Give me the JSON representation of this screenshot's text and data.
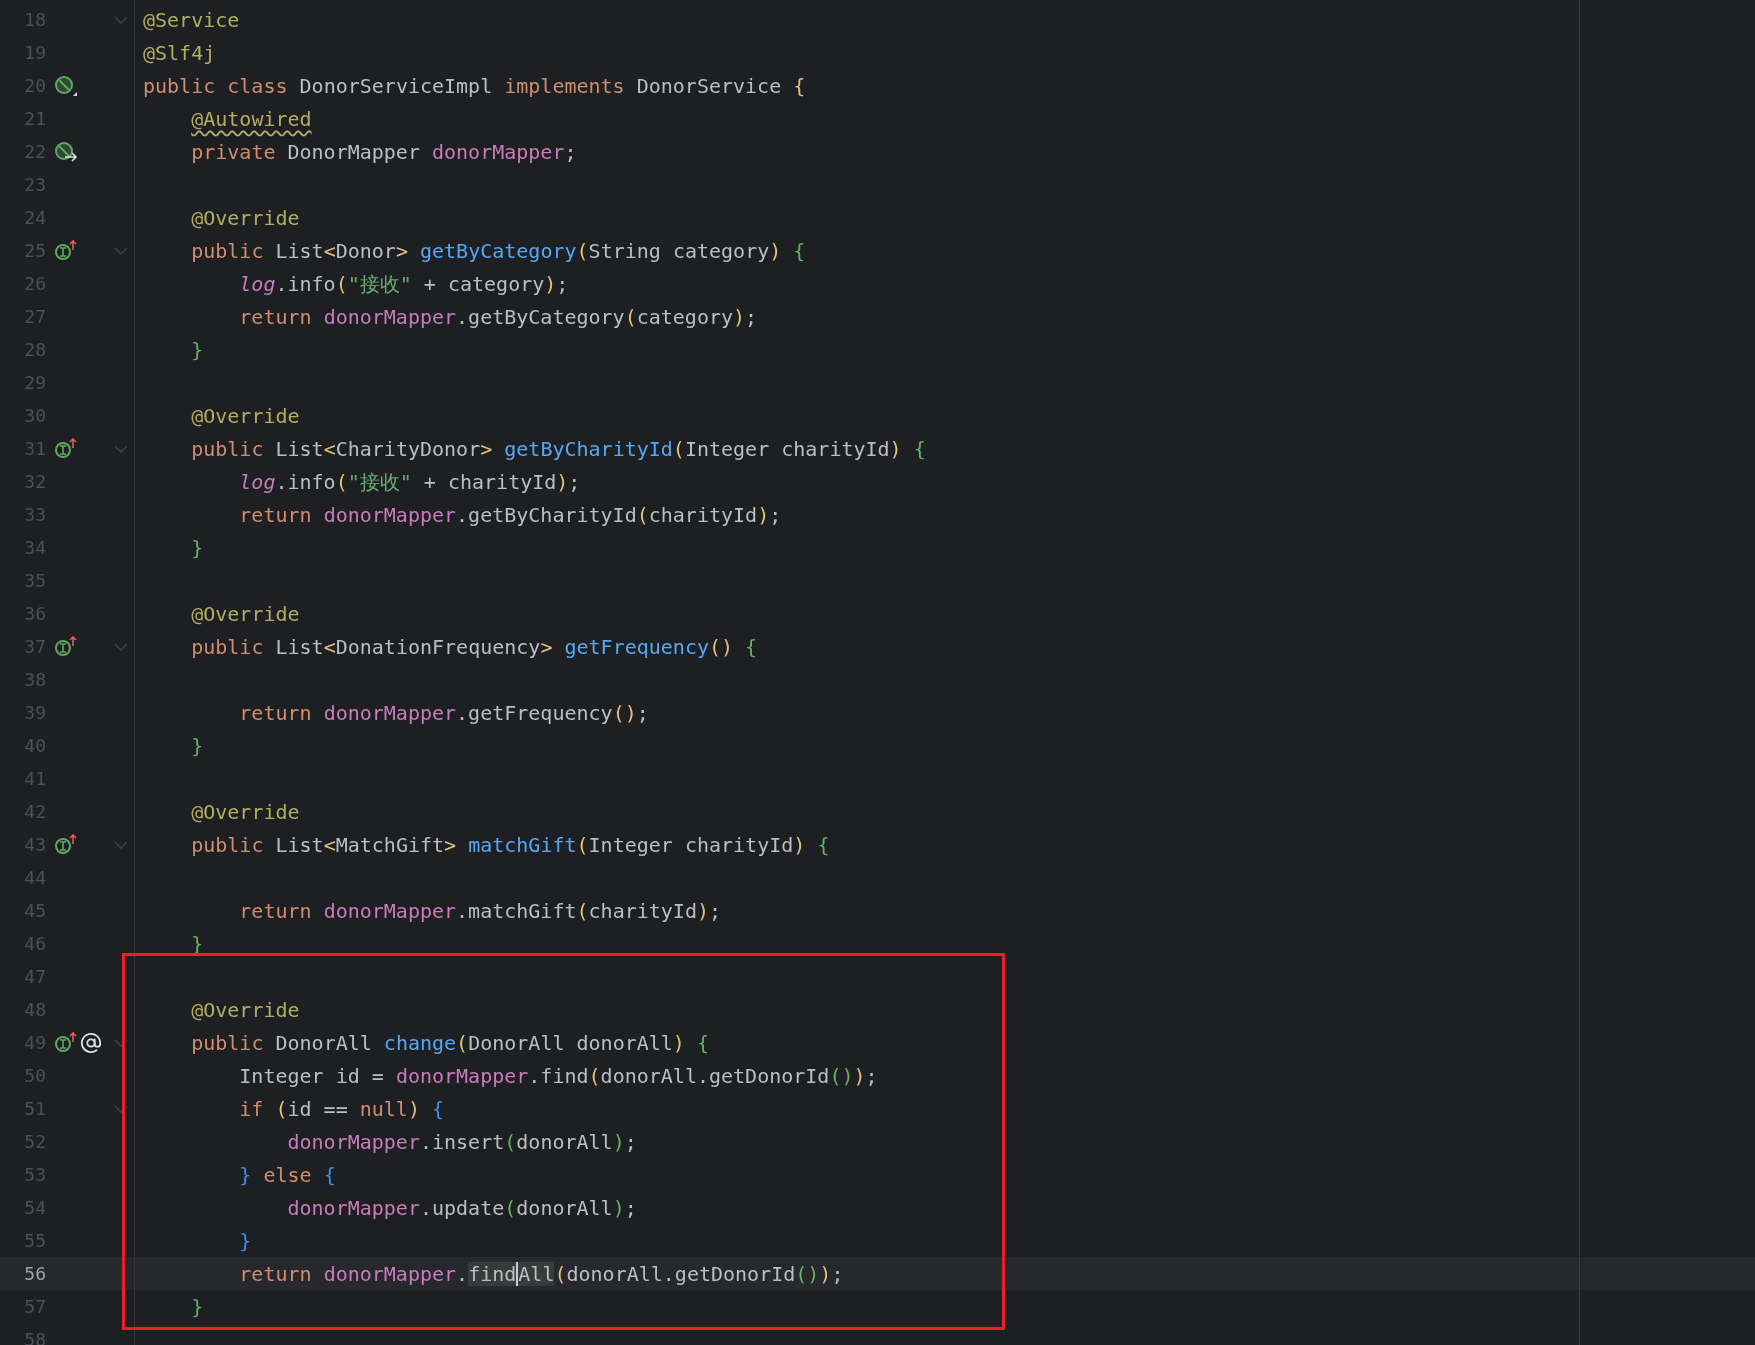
{
  "editor": {
    "lines": [
      {
        "number": "18",
        "fold": true,
        "current": false,
        "tokens": [
          {
            "kind": "annotation",
            "text": "@Service"
          }
        ]
      },
      {
        "number": "19",
        "fold": false,
        "current": false,
        "tokens": [
          {
            "kind": "annotation",
            "text": "@Slf4j"
          }
        ]
      },
      {
        "number": "20",
        "fold": false,
        "current": false,
        "gutter_icons": [
          {
            "kind": "bean"
          }
        ],
        "tokens": [
          {
            "kind": "keyword",
            "text": "public class "
          },
          {
            "kind": "plain",
            "text": "DonorServiceImpl "
          },
          {
            "kind": "keyword",
            "text": "implements "
          },
          {
            "kind": "plain",
            "text": "DonorService "
          },
          {
            "kind": "bracket1",
            "text": "{"
          }
        ]
      },
      {
        "number": "21",
        "fold": false,
        "current": false,
        "tokens": [
          {
            "kind": "annotation-warning",
            "text": "    @Autowired"
          }
        ]
      },
      {
        "number": "22",
        "fold": false,
        "current": false,
        "gutter_icons": [
          {
            "kind": "bean-inject"
          }
        ],
        "tokens": [
          {
            "kind": "keyword",
            "text": "    private "
          },
          {
            "kind": "plain",
            "text": "DonorMapper "
          },
          {
            "kind": "field",
            "text": "donorMapper"
          },
          {
            "kind": "plain",
            "text": ";"
          }
        ]
      },
      {
        "number": "23",
        "fold": false,
        "current": false
      },
      {
        "number": "24",
        "fold": false,
        "current": false,
        "tokens": [
          {
            "kind": "annotation",
            "text": "    @Override"
          }
        ]
      },
      {
        "number": "25",
        "fold": true,
        "current": false,
        "gutter_icons": [
          {
            "kind": "implements"
          }
        ],
        "tokens": [
          {
            "kind": "keyword",
            "text": "    public "
          },
          {
            "kind": "plain",
            "text": "List"
          },
          {
            "kind": "bracket1",
            "text": "<"
          },
          {
            "kind": "plain",
            "text": "Donor"
          },
          {
            "kind": "bracket1",
            "text": "> "
          },
          {
            "kind": "function",
            "text": "getByCategory"
          },
          {
            "kind": "bracket1",
            "text": "("
          },
          {
            "kind": "plain",
            "text": "String category"
          },
          {
            "kind": "bracket1",
            "text": ") "
          },
          {
            "kind": "bracket2",
            "text": "{"
          }
        ]
      },
      {
        "number": "26",
        "fold": false,
        "current": false,
        "tokens": [
          {
            "kind": "static",
            "text": "        log"
          },
          {
            "kind": "plain",
            "text": ".info"
          },
          {
            "kind": "bracket1",
            "text": "("
          },
          {
            "kind": "string",
            "text": "\"接收\""
          },
          {
            "kind": "plain",
            "text": " + category"
          },
          {
            "kind": "bracket1",
            "text": ")"
          },
          {
            "kind": "plain",
            "text": ";"
          }
        ]
      },
      {
        "number": "27",
        "fold": false,
        "current": false,
        "tokens": [
          {
            "kind": "keyword",
            "text": "        return "
          },
          {
            "kind": "field",
            "text": "donorMapper"
          },
          {
            "kind": "plain",
            "text": ".getByCategory"
          },
          {
            "kind": "bracket1",
            "text": "("
          },
          {
            "kind": "plain",
            "text": "category"
          },
          {
            "kind": "bracket1",
            "text": ")"
          },
          {
            "kind": "plain",
            "text": ";"
          }
        ]
      },
      {
        "number": "28",
        "fold": false,
        "current": false,
        "tokens": [
          {
            "kind": "bracket2",
            "text": "    }"
          }
        ]
      },
      {
        "number": "29",
        "fold": false,
        "current": false
      },
      {
        "number": "30",
        "fold": false,
        "current": false,
        "tokens": [
          {
            "kind": "annotation",
            "text": "    @Override"
          }
        ]
      },
      {
        "number": "31",
        "fold": true,
        "current": false,
        "gutter_icons": [
          {
            "kind": "implements"
          }
        ],
        "tokens": [
          {
            "kind": "keyword",
            "text": "    public "
          },
          {
            "kind": "plain",
            "text": "List"
          },
          {
            "kind": "bracket1",
            "text": "<"
          },
          {
            "kind": "plain",
            "text": "CharityDonor"
          },
          {
            "kind": "bracket1",
            "text": "> "
          },
          {
            "kind": "function",
            "text": "getByCharityId"
          },
          {
            "kind": "bracket1",
            "text": "("
          },
          {
            "kind": "plain",
            "text": "Integer charityId"
          },
          {
            "kind": "bracket1",
            "text": ") "
          },
          {
            "kind": "bracket2",
            "text": "{"
          }
        ]
      },
      {
        "number": "32",
        "fold": false,
        "current": false,
        "tokens": [
          {
            "kind": "static",
            "text": "        log"
          },
          {
            "kind": "plain",
            "text": ".info"
          },
          {
            "kind": "bracket1",
            "text": "("
          },
          {
            "kind": "string",
            "text": "\"接收\""
          },
          {
            "kind": "plain",
            "text": " + charityId"
          },
          {
            "kind": "bracket1",
            "text": ")"
          },
          {
            "kind": "plain",
            "text": ";"
          }
        ]
      },
      {
        "number": "33",
        "fold": false,
        "current": false,
        "tokens": [
          {
            "kind": "keyword",
            "text": "        return "
          },
          {
            "kind": "field",
            "text": "donorMapper"
          },
          {
            "kind": "plain",
            "text": ".getByCharityId"
          },
          {
            "kind": "bracket1",
            "text": "("
          },
          {
            "kind": "plain",
            "text": "charityId"
          },
          {
            "kind": "bracket1",
            "text": ")"
          },
          {
            "kind": "plain",
            "text": ";"
          }
        ]
      },
      {
        "number": "34",
        "fold": false,
        "current": false,
        "tokens": [
          {
            "kind": "bracket2",
            "text": "    }"
          }
        ]
      },
      {
        "number": "35",
        "fold": false,
        "current": false
      },
      {
        "number": "36",
        "fold": false,
        "current": false,
        "tokens": [
          {
            "kind": "annotation",
            "text": "    @Override"
          }
        ]
      },
      {
        "number": "37",
        "fold": true,
        "current": false,
        "gutter_icons": [
          {
            "kind": "implements"
          }
        ],
        "tokens": [
          {
            "kind": "keyword",
            "text": "    public "
          },
          {
            "kind": "plain",
            "text": "List"
          },
          {
            "kind": "bracket1",
            "text": "<"
          },
          {
            "kind": "plain",
            "text": "DonationFrequency"
          },
          {
            "kind": "bracket1",
            "text": "> "
          },
          {
            "kind": "function",
            "text": "getFrequency"
          },
          {
            "kind": "bracket1",
            "text": "() "
          },
          {
            "kind": "bracket2",
            "text": "{"
          }
        ]
      },
      {
        "number": "38",
        "fold": false,
        "current": false
      },
      {
        "number": "39",
        "fold": false,
        "current": false,
        "tokens": [
          {
            "kind": "keyword",
            "text": "        return "
          },
          {
            "kind": "field",
            "text": "donorMapper"
          },
          {
            "kind": "plain",
            "text": ".getFrequency"
          },
          {
            "kind": "bracket1",
            "text": "()"
          },
          {
            "kind": "plain",
            "text": ";"
          }
        ]
      },
      {
        "number": "40",
        "fold": false,
        "current": false,
        "tokens": [
          {
            "kind": "bracket2",
            "text": "    }"
          }
        ]
      },
      {
        "number": "41",
        "fold": false,
        "current": false
      },
      {
        "number": "42",
        "fold": false,
        "current": false,
        "tokens": [
          {
            "kind": "annotation",
            "text": "    @Override"
          }
        ]
      },
      {
        "number": "43",
        "fold": true,
        "current": false,
        "gutter_icons": [
          {
            "kind": "implements"
          }
        ],
        "tokens": [
          {
            "kind": "keyword",
            "text": "    public "
          },
          {
            "kind": "plain",
            "text": "List"
          },
          {
            "kind": "bracket1",
            "text": "<"
          },
          {
            "kind": "plain",
            "text": "MatchGift"
          },
          {
            "kind": "bracket1",
            "text": "> "
          },
          {
            "kind": "function",
            "text": "matchGift"
          },
          {
            "kind": "bracket1",
            "text": "("
          },
          {
            "kind": "plain",
            "text": "Integer charityId"
          },
          {
            "kind": "bracket1",
            "text": ") "
          },
          {
            "kind": "bracket2",
            "text": "{"
          }
        ]
      },
      {
        "number": "44",
        "fold": false,
        "current": false
      },
      {
        "number": "45",
        "fold": false,
        "current": false,
        "tokens": [
          {
            "kind": "keyword",
            "text": "        return "
          },
          {
            "kind": "field",
            "text": "donorMapper"
          },
          {
            "kind": "plain",
            "text": ".matchGift"
          },
          {
            "kind": "bracket1",
            "text": "("
          },
          {
            "kind": "plain",
            "text": "charityId"
          },
          {
            "kind": "bracket1",
            "text": ")"
          },
          {
            "kind": "plain",
            "text": ";"
          }
        ]
      },
      {
        "number": "46",
        "fold": false,
        "current": false,
        "tokens": [
          {
            "kind": "bracket2",
            "text": "    }"
          }
        ]
      },
      {
        "number": "47",
        "fold": false,
        "current": false
      },
      {
        "number": "48",
        "fold": false,
        "current": false,
        "tokens": [
          {
            "kind": "annotation",
            "text": "    @Override"
          }
        ]
      },
      {
        "number": "49",
        "fold": true,
        "current": false,
        "gutter_icons": [
          {
            "kind": "implements"
          },
          {
            "kind": "at"
          }
        ],
        "tokens": [
          {
            "kind": "keyword",
            "text": "    public "
          },
          {
            "kind": "plain",
            "text": "DonorAll "
          },
          {
            "kind": "function",
            "text": "change"
          },
          {
            "kind": "bracket1",
            "text": "("
          },
          {
            "kind": "plain",
            "text": "DonorAll donorAll"
          },
          {
            "kind": "bracket1",
            "text": ") "
          },
          {
            "kind": "bracket2",
            "text": "{"
          }
        ]
      },
      {
        "number": "50",
        "fold": false,
        "current": false,
        "tokens": [
          {
            "kind": "plain",
            "text": "        Integer id = "
          },
          {
            "kind": "field",
            "text": "donorMapper"
          },
          {
            "kind": "plain",
            "text": ".find"
          },
          {
            "kind": "bracket1",
            "text": "("
          },
          {
            "kind": "plain",
            "text": "donorAll.getDonorId"
          },
          {
            "kind": "bracket2",
            "text": "()"
          },
          {
            "kind": "bracket1",
            "text": ")"
          },
          {
            "kind": "plain",
            "text": ";"
          }
        ]
      },
      {
        "number": "51",
        "fold": true,
        "current": false,
        "tokens": [
          {
            "kind": "keyword",
            "text": "        if "
          },
          {
            "kind": "bracket1",
            "text": "("
          },
          {
            "kind": "plain",
            "text": "id == "
          },
          {
            "kind": "keyword",
            "text": "null"
          },
          {
            "kind": "bracket1",
            "text": ") "
          },
          {
            "kind": "bracket3",
            "text": "{"
          }
        ]
      },
      {
        "number": "52",
        "fold": false,
        "current": false,
        "tokens": [
          {
            "kind": "field",
            "text": "            donorMapper"
          },
          {
            "kind": "plain",
            "text": ".insert"
          },
          {
            "kind": "bracket2",
            "text": "("
          },
          {
            "kind": "plain",
            "text": "donorAll"
          },
          {
            "kind": "bracket2",
            "text": ")"
          },
          {
            "kind": "plain",
            "text": ";"
          }
        ]
      },
      {
        "number": "53",
        "fold": false,
        "current": false,
        "tokens": [
          {
            "kind": "bracket3",
            "text": "        }"
          },
          {
            "kind": "keyword",
            "text": " else "
          },
          {
            "kind": "bracket3",
            "text": "{"
          }
        ]
      },
      {
        "number": "54",
        "fold": false,
        "current": false,
        "tokens": [
          {
            "kind": "field",
            "text": "            donorMapper"
          },
          {
            "kind": "plain",
            "text": ".update"
          },
          {
            "kind": "bracket2",
            "text": "("
          },
          {
            "kind": "plain",
            "text": "donorAll"
          },
          {
            "kind": "bracket2",
            "text": ")"
          },
          {
            "kind": "plain",
            "text": ";"
          }
        ]
      },
      {
        "number": "55",
        "fold": false,
        "current": false,
        "tokens": [
          {
            "kind": "bracket3",
            "text": "        }"
          }
        ]
      },
      {
        "number": "56",
        "fold": false,
        "current": true,
        "tokens": [
          {
            "kind": "keyword",
            "text": "        return "
          },
          {
            "kind": "field",
            "text": "donorMapper"
          },
          {
            "kind": "plain",
            "text": "."
          },
          {
            "kind": "highlight",
            "text": "find"
          },
          {
            "kind": "highlight-caret",
            "text": "All"
          },
          {
            "kind": "bracket1",
            "text": "("
          },
          {
            "kind": "plain",
            "text": "donorAll.getDonorId"
          },
          {
            "kind": "bracket2",
            "text": "()"
          },
          {
            "kind": "bracket1",
            "text": ")"
          },
          {
            "kind": "plain",
            "text": ";"
          }
        ]
      },
      {
        "number": "57",
        "fold": false,
        "current": false,
        "tokens": [
          {
            "kind": "bracket2",
            "text": "    }"
          }
        ]
      },
      {
        "number": "58",
        "fold": false,
        "current": false
      }
    ]
  }
}
